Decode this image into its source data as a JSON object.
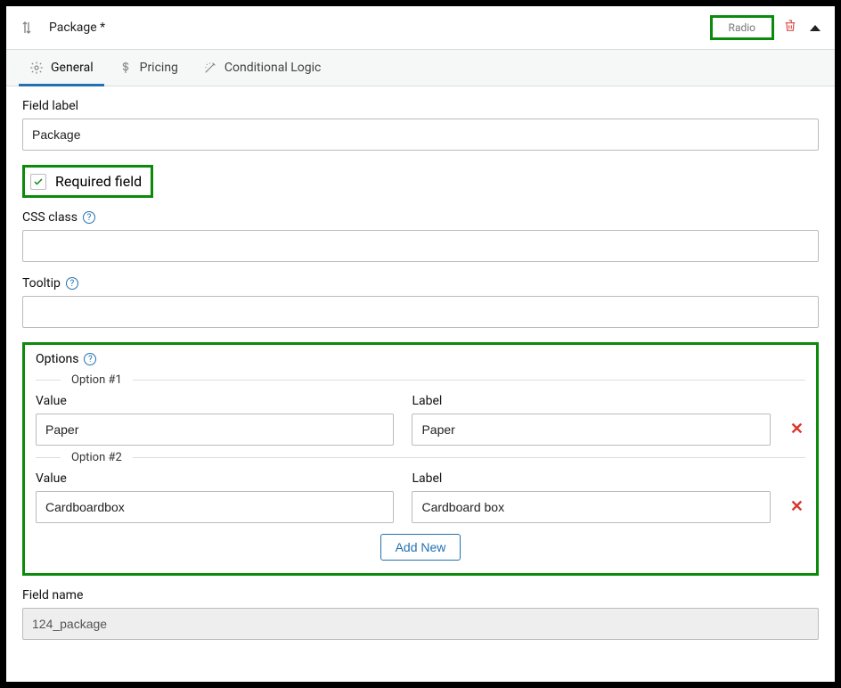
{
  "header": {
    "title": "Package *",
    "badge": "Radio"
  },
  "tabs": [
    {
      "label": "General"
    },
    {
      "label": "Pricing"
    },
    {
      "label": "Conditional Logic"
    }
  ],
  "fields": {
    "field_label_label": "Field label",
    "field_label_value": "Package",
    "required_label": "Required field",
    "css_class_label": "CSS class",
    "css_class_value": "",
    "tooltip_label": "Tooltip",
    "tooltip_value": "",
    "options_label": "Options",
    "add_new_label": "Add New",
    "field_name_label": "Field name",
    "field_name_value": "124_package"
  },
  "options": [
    {
      "legend": "Option #1",
      "value_label": "Value",
      "value": "Paper",
      "label_label": "Label",
      "label": "Paper"
    },
    {
      "legend": "Option #2",
      "value_label": "Value",
      "value": "Cardboardbox",
      "label_label": "Label",
      "label": "Cardboard box"
    }
  ]
}
